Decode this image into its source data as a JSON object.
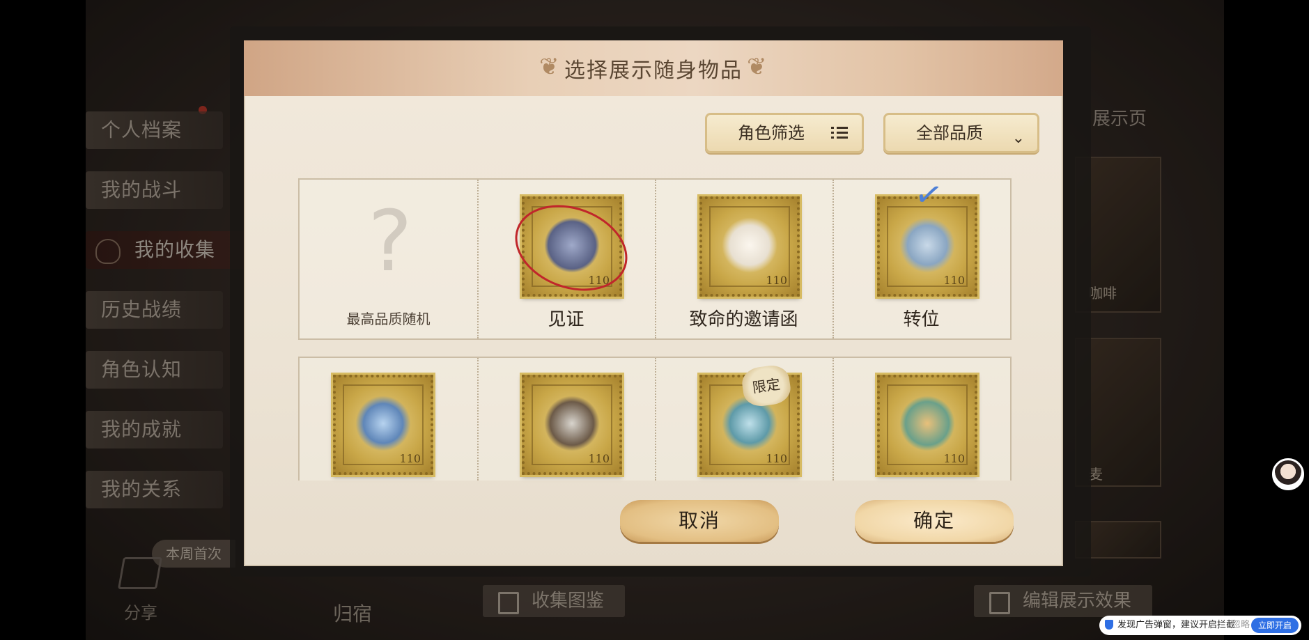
{
  "background": {
    "menu_items": [
      "个人档案",
      "我的战斗",
      "我的收集",
      "历史战绩",
      "角色认知",
      "我的成就",
      "我的关系"
    ],
    "active_index": 2,
    "weekly_tag": "本周首次",
    "share_label": "分享",
    "bottom_left_text": "归宿",
    "collection_button": "收集图鉴",
    "edit_button": "编辑展示效果",
    "right_label": "展示页",
    "right_card_texts": [
      "咖啡",
      "麦"
    ]
  },
  "dialog": {
    "title": "选择展示随身物品",
    "role_filter_label": "角色筛选",
    "quality_select": "全部品质",
    "items": [
      {
        "label": "最高品质随机",
        "type": "random"
      },
      {
        "label": "见证",
        "type": "stamp",
        "circled": true
      },
      {
        "label": "致命的邀请函",
        "type": "stamp"
      },
      {
        "label": "转位",
        "type": "stamp",
        "selected": true
      },
      {
        "label": "",
        "type": "stamp"
      },
      {
        "label": "",
        "type": "stamp"
      },
      {
        "label": "",
        "type": "stamp",
        "limited": "限定"
      },
      {
        "label": "",
        "type": "stamp"
      }
    ],
    "stamp_number": "110",
    "cancel_label": "取消",
    "confirm_label": "确定"
  },
  "overlay": {
    "ad_message": "发现广告弹窗，建议开启拦截",
    "ignore_label": "忽略",
    "open_label": "立即开启"
  },
  "colors": {
    "header_gradient": "#d0a585",
    "button_gold": "#e3bf83",
    "accent_blue": "#2f6fe4",
    "circle_red": "#c0262b"
  }
}
